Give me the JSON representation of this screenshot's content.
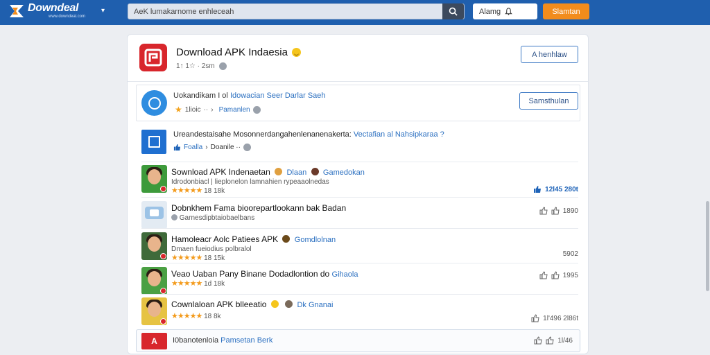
{
  "header": {
    "logo_text": "Downdeal",
    "logo_tagline": "www.downdeal.com",
    "search_placeholder": "AeK lumakarnome enhleceah",
    "notif_label": "Alamg",
    "signup_label": "Slamtan",
    "colors": {
      "bar": "#1f5fae",
      "signup": "#f28c1c"
    }
  },
  "app": {
    "title": "Download APK Indaesia",
    "meta": "1↑ 1☆ · 2sm",
    "open_button": "A henhlaw"
  },
  "subscription": {
    "title_prefix": "Uokandikam I ol",
    "title_link": "Idowacian Seer Darlar Saeh",
    "rating_label": "1lioic",
    "separator": "··",
    "meta_link": "Pamanlen",
    "subscribe_button": "Samsthulan"
  },
  "topic": {
    "title": "Ureandestaisahe Mosonnerdangahenlenanenakerta:",
    "title_link": "Vectafian al Nahsipkaraa ?",
    "like_label": "Foalla",
    "meta": "Doanile ··"
  },
  "list": [
    {
      "title": "Sownload APK Indenaetan",
      "link": "Dlaan",
      "link2": "Gamedokan",
      "sub": "Idrodonbiacl | lieplonelon lamnahien rypeaaolnedas",
      "rating": "18 18k",
      "right": "12l45 280t",
      "right_style": "blue"
    },
    {
      "title": "Dobnkhem Fama bioorepartlookann bak Badan",
      "link": "",
      "link2": "",
      "sub": "Garnesdipbtaiobaelbans",
      "rating": "",
      "right": "1890",
      "right_style": "normal"
    },
    {
      "title": "Hamoleacr Aolc Patiees APK",
      "link": "Gomdlolnan",
      "link2": "",
      "sub": "Dmaen fueiodius polbralol",
      "rating": "18 15k",
      "right": "5902",
      "right_style": "plain"
    },
    {
      "title": "Veao Uaban Pany Binane Dodadlontion do",
      "link": "Gihaola",
      "link2": "",
      "sub": "",
      "rating": "1d 18k",
      "right": "1995",
      "right_style": "normal"
    },
    {
      "title": "Cownlaloan APK blleeatio",
      "link": "Dk Gnanai",
      "link2": "",
      "sub": "",
      "rating": "18 8k",
      "right": "1l'496 2l86t",
      "right_style": "normal"
    }
  ],
  "footer": {
    "icon_letter": "A",
    "text": "I0banotenloia",
    "link": "Pamsetan Berk",
    "right": "1l/46"
  }
}
